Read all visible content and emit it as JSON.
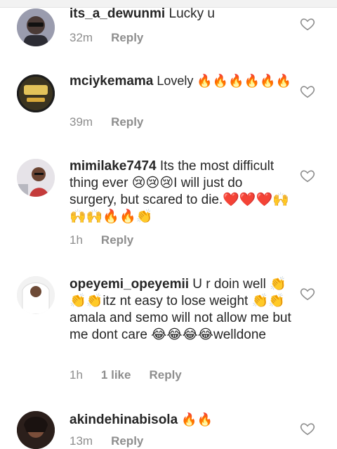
{
  "comments": [
    {
      "username": "its_a_dewunmi",
      "text": " Lucky u",
      "time": "32m",
      "reply_label": "Reply",
      "avatar_icon": "avatar-man-sunglasses"
    },
    {
      "username": "mciykemama",
      "text": " Lovely 🔥🔥🔥🔥🔥🔥",
      "time": "39m",
      "reply_label": "Reply",
      "avatar_icon": "avatar-brand-logo"
    },
    {
      "username": "mimilake7474",
      "text": " Its the most difficult thing ever 😢😢😢I will just do surgery,  but scared to die.❤️❤️❤️🙌🙌🙌🔥🔥👏",
      "time": "1h",
      "reply_label": "Reply",
      "avatar_icon": "avatar-woman"
    },
    {
      "username": "opeyemi_opeyemii",
      "text": " U r doin well 👏👏👏itz nt easy to lose weight 👏👏amala and semo will not allow me but me dont care 😂😂😂😂welldone",
      "time": "1h",
      "likes": "1 like",
      "reply_label": "Reply",
      "avatar_icon": "avatar-white-outfit"
    },
    {
      "username": "akindehinabisola",
      "text": " 🔥🔥",
      "time": "13m",
      "reply_label": "Reply",
      "avatar_icon": "avatar-woman-dark"
    }
  ],
  "heart_icon": "heart-outline-icon"
}
